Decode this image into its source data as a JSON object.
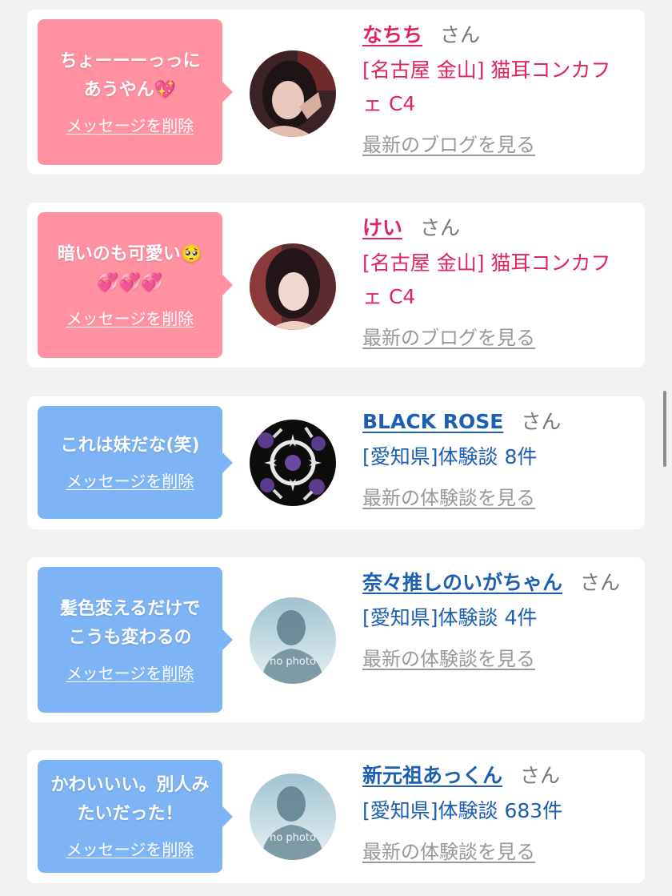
{
  "colors": {
    "background": "#f2f2f2",
    "pink_bubble": "#ff91a0",
    "blue_bubble": "#7db4f5",
    "pink_text": "#e0245c",
    "blue_text": "#1c5fb0",
    "muted_link": "#999999"
  },
  "delete_label": "メッセージを削除",
  "honorific": "さん",
  "items": [
    {
      "message_line1": "ちょーーーっっに",
      "message_line2": "あうやん💖",
      "name": "なちち",
      "shop_line1": "[名古屋 金山] 猫耳コンカフ",
      "shop_line2": "ェ C4",
      "link": "最新のブログを見る"
    },
    {
      "message_line1": "暗いのも可愛い🥺",
      "message_line2": "💞💞💞",
      "name": "けい",
      "shop_line1": "[名古屋 金山] 猫耳コンカフ",
      "shop_line2": "ェ C4",
      "link": "最新のブログを見る"
    },
    {
      "message_line1": "これは妹だな(笑)",
      "name": "BLACK ROSE",
      "shop_line1": "[愛知県]体験談 8件",
      "link": "最新の体験談を見る"
    },
    {
      "message_line1": "髪色変えるだけで",
      "message_line2": "こうも変わるの",
      "name": "奈々推しのいがちゃん",
      "name_suffix_line2": "ん",
      "shop_line1": "[愛知県]体験談 4件",
      "avatar_text": "no photo",
      "link": "最新の体験談を見る"
    },
    {
      "message_line1": "かわいいい。別人み",
      "message_line2": "たいだった！",
      "name": "新元祖あっくん",
      "shop_line1": "[愛知県]体験談 683件",
      "avatar_text": "no photo",
      "link": "最新の体験談を見る"
    }
  ]
}
